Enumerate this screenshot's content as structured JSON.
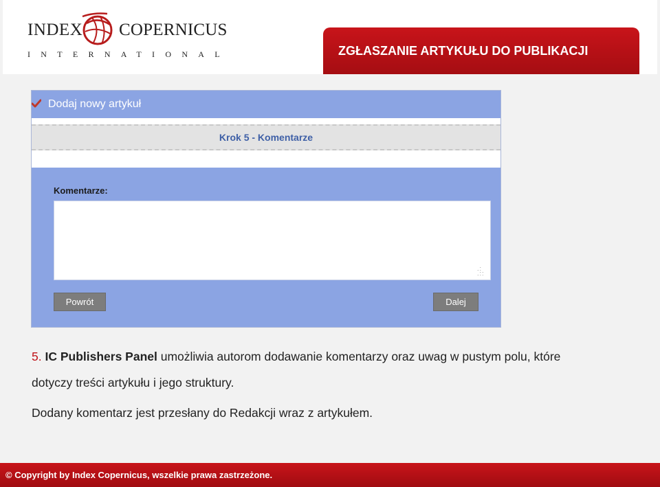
{
  "header": {
    "logo": {
      "word_left": "INDEX",
      "word_right": "COPERNICUS",
      "word_bottom": "INTERNATIONAL"
    },
    "title": "ZGŁASZANIE ARTYKUŁU DO PUBLIKACJI"
  },
  "panel": {
    "header_title": "Dodaj nowy artykuł",
    "step_label": "Krok 5 - Komentarze",
    "comments_label": "Komentarze:",
    "comments_value": "",
    "back_button": "Powrót",
    "next_button": "Dalej"
  },
  "description": {
    "number": "5.",
    "product": "IC Publishers Panel",
    "line1_rest": " umożliwia autorom dodawanie komentarzy oraz uwag w pustym polu, które",
    "line2": "dotyczy treści artykułu i jego struktury.",
    "line3": "Dodany komentarz jest przesłany do Redakcji wraz z artykułem."
  },
  "footer": {
    "copyright": "© Copyright by Index Copernicus, wszelkie prawa zastrzeżone."
  },
  "colors": {
    "brand_red": "#c8141a",
    "panel_blue": "#8ba4e3",
    "step_text": "#3e5fa6",
    "button_gray": "#7d7d7d"
  }
}
